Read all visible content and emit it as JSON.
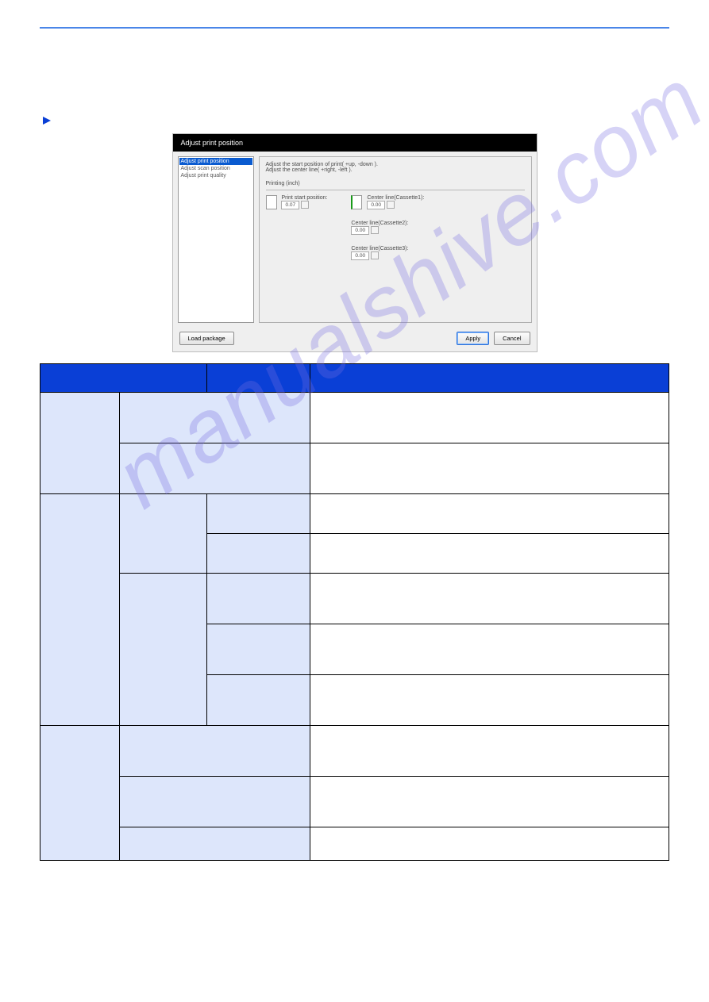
{
  "divider": {
    "present": true
  },
  "arrow_row": {
    "icon": "arrow-right"
  },
  "screenshot": {
    "title": "Adjust print position",
    "sidebar": {
      "selected": "Adjust print position",
      "items": [
        "Adjust scan position",
        "Adjust print quality"
      ]
    },
    "instructions_line1": "Adjust the start position of print( +up, -down ).",
    "instructions_line2": "Adjust the center line( +right, -left ).",
    "group_label": "Printing (inch)",
    "left_field": {
      "label": "Print start position:",
      "value": "0.07"
    },
    "right_fields": [
      {
        "label": "Center line(Cassette1):",
        "value": "0.00"
      },
      {
        "label": "Center line(Cassette2):",
        "value": "0.00"
      },
      {
        "label": "Center line(Cassette3):",
        "value": "0.00"
      }
    ],
    "buttons": {
      "load": "Load package",
      "apply": "Apply",
      "cancel": "Cancel"
    }
  },
  "table": {
    "headers": [
      "",
      "",
      ""
    ],
    "rows": [
      {
        "c1": "",
        "c2span": "",
        "desc": ""
      },
      {
        "c2span": "",
        "desc": ""
      },
      {
        "c1": "",
        "c2": "",
        "c3": "",
        "desc": ""
      },
      {
        "c3": "",
        "desc": ""
      },
      {
        "c2": "",
        "c3": "",
        "desc": ""
      },
      {
        "c3": "",
        "desc": ""
      },
      {
        "c3": "",
        "desc": ""
      },
      {
        "c1": "",
        "c2span": "",
        "desc": ""
      },
      {
        "c2span": "",
        "desc": ""
      },
      {
        "c2span": "",
        "desc": ""
      }
    ]
  },
  "watermark": "manualshive.com"
}
